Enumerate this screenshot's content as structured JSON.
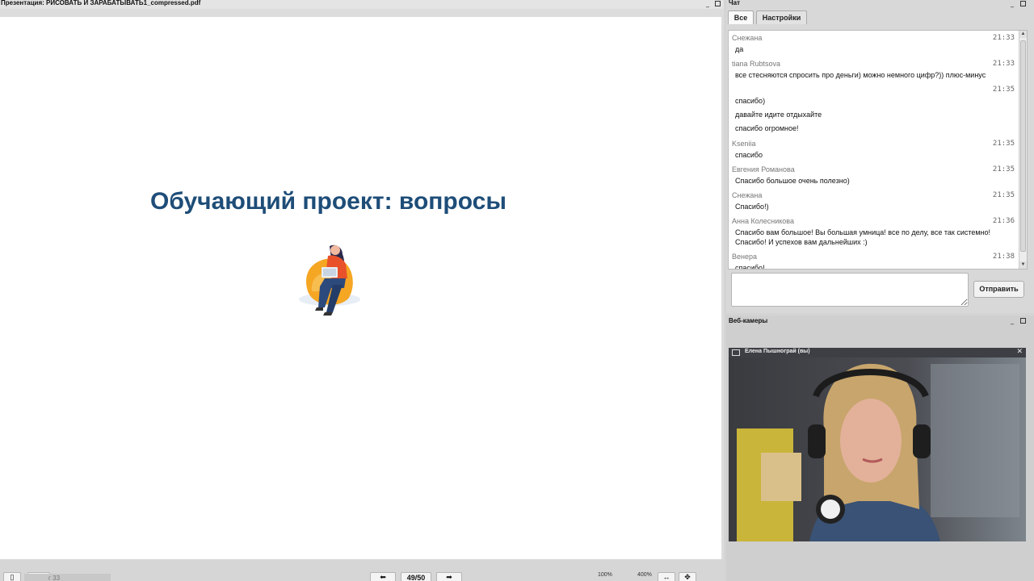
{
  "presentation": {
    "title": "Презентация: РИСОВАТЬ И ЗАРАБАТЫВАТЬ1_compressed.pdf",
    "slide_heading": "Обучающий проект: вопросы",
    "page_indicator": "49/50",
    "page_field": "г 33",
    "zoom_min": "100%",
    "zoom_max": "400%"
  },
  "chat": {
    "title": "Чат",
    "tabs": [
      {
        "label": "Все",
        "active": true
      },
      {
        "label": "Настройки",
        "active": false
      }
    ],
    "messages": [
      {
        "author": "Снежана",
        "time": "21:33",
        "text": "да"
      },
      {
        "author": "tiana Rubtsova",
        "time": "21:33",
        "text": "все стесняются спросить про деньги) можно немного цифр?)) плюс-минус"
      },
      {
        "author": "",
        "time": "21:35",
        "text": "спасибо)"
      },
      {
        "author": "",
        "time": "",
        "text": "давайте идите отдыхайте"
      },
      {
        "author": "",
        "time": "",
        "text": "спасибо огромное!"
      },
      {
        "author": "Kseniia",
        "time": "21:35",
        "text": "спасибо"
      },
      {
        "author": "Евгения Романова",
        "time": "21:35",
        "text": "Спасибо большое очень полезно)"
      },
      {
        "author": "Снежана",
        "time": "21:35",
        "text": "Спасибо!)"
      },
      {
        "author": "Анна Колесникова",
        "time": "21:36",
        "text": "Спасибо вам большое! Вы большая умница! все по делу, все так системно!",
        "text2": "Спасибо! И успехов вам дальнейших :)"
      },
      {
        "author": "Венера",
        "time": "21:38",
        "text": "спасибо!"
      }
    ],
    "send_label": "Отправить",
    "input_value": ""
  },
  "webcams": {
    "title": "Веб-камеры",
    "participant": "Елена Пышнограй (вы)"
  },
  "colors": {
    "heading": "#1e4d78",
    "slide_bg": "#ffffff",
    "panel_bg": "#d8d8d8"
  }
}
